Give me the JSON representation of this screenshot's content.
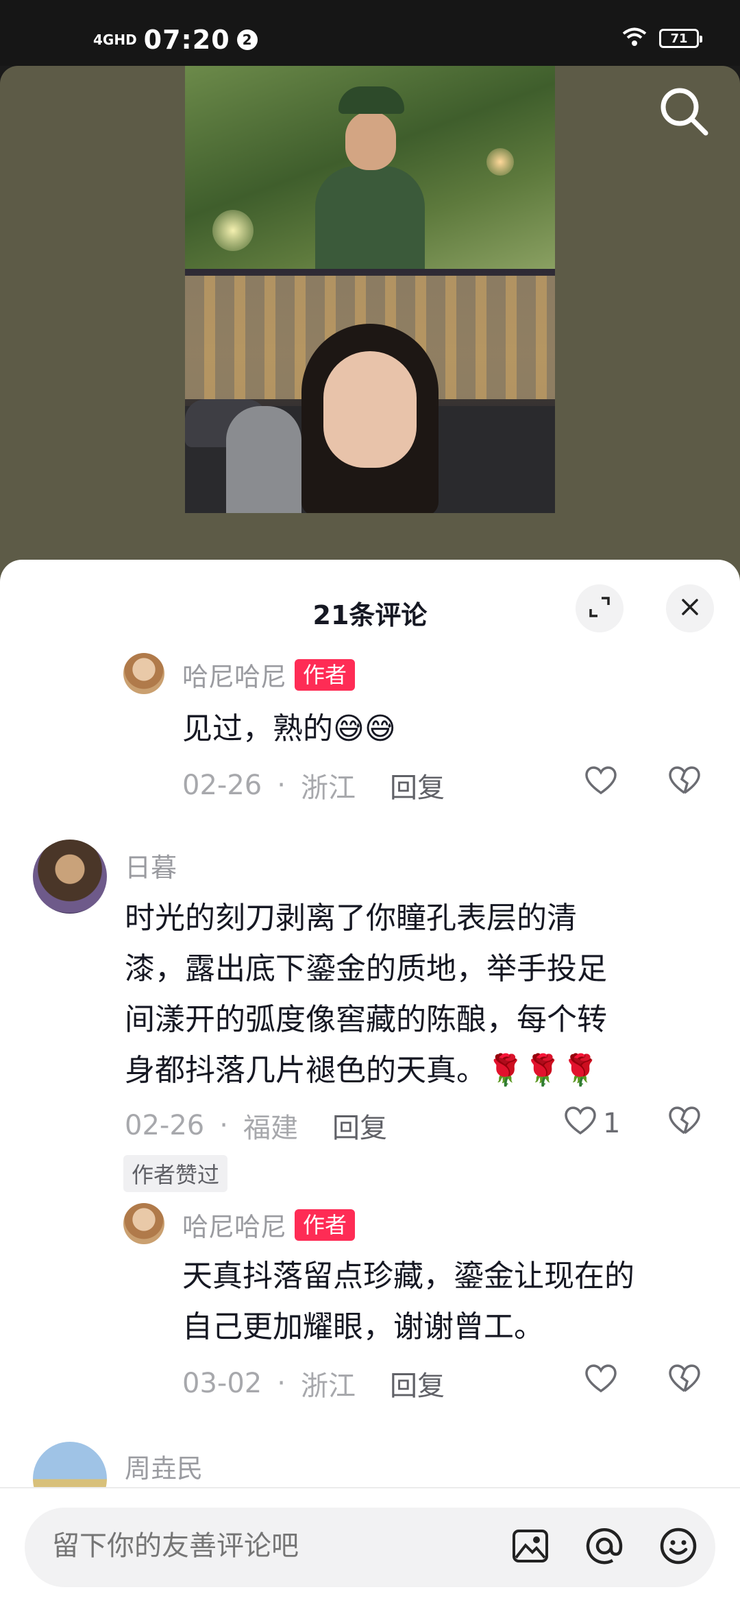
{
  "status_bar": {
    "network": "4GHD",
    "time": "07:20",
    "notification_count": "2",
    "battery": "71"
  },
  "video": {
    "search_icon": "search-icon"
  },
  "comments_header": {
    "title": "21条评论",
    "expand_icon": "expand-icon",
    "close_icon": "close-icon"
  },
  "comments": [
    {
      "name": "哈尼哈尼",
      "author_tag": "作者",
      "text": "见过，熟的😅😅",
      "date": "02-26",
      "region": "浙江",
      "reply": "回复",
      "likes": ""
    },
    {
      "name": "日暮",
      "text_lines": [
        "时光的刻刀剥离了你瞳孔表层的清",
        "漆，露出底下鎏金的质地，举手投足",
        "间漾开的弧度像窖藏的陈酿，每个转",
        "身都抖落几片褪色的天真。🌹🌹🌹"
      ],
      "date": "02-26",
      "region": "福建",
      "reply": "回复",
      "likes": "1",
      "author_liked": "作者赞过"
    },
    {
      "name": "哈尼哈尼",
      "author_tag": "作者",
      "text_lines": [
        "天真抖落留点珍藏，鎏金让现在的",
        "自己更加耀眼，谢谢曾工。"
      ],
      "date": "03-02",
      "region": "浙江",
      "reply": "回复",
      "likes": ""
    },
    {
      "name": "周垚民"
    }
  ],
  "input": {
    "placeholder": "留下你的友善评论吧",
    "image_icon": "image-icon",
    "mention_icon": "at-icon",
    "emoji_icon": "emoji-icon"
  },
  "colors": {
    "accent": "#fe2c55",
    "video_bg": "#5d5b47"
  }
}
